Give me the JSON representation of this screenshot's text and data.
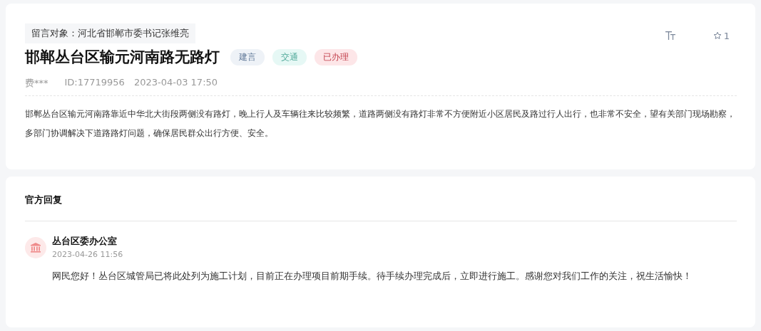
{
  "post": {
    "target": "留言对象：河北省邯郸市委书记张维亮",
    "title": "邯郸丛台区输元河南路无路灯",
    "tags": [
      {
        "label": "建言",
        "color": "#eef2f7"
      },
      {
        "label": "交通",
        "color": "#e6f8f5"
      },
      {
        "label": "已办理",
        "color": "#fde6e8"
      }
    ],
    "favorite_count": "1",
    "author": "费***",
    "id": "ID:17719956",
    "time": "2023-04-03 17:50",
    "body": "邯郸丛台区输元河南路靠近中华北大街段两侧没有路灯，晚上行人及车辆往来比较频繁，道路两侧没有路灯非常不方便附近小区居民及路过行人出行，也非常不安全，望有关部门现场勘察，多部门协调解决下道路路灯问题，确保居民群众出行方便、安全。"
  },
  "reply": {
    "heading": "官方回复",
    "office": "丛台区委办公室",
    "time": "2023-04-26 11:56",
    "text": "网民您好！丛台区城管局已将此处列为施工计划，目前正在办理项目前期手续。待手续办理完成后，立即进行施工。感谢您对我们工作的关注，祝生活愉快！"
  }
}
